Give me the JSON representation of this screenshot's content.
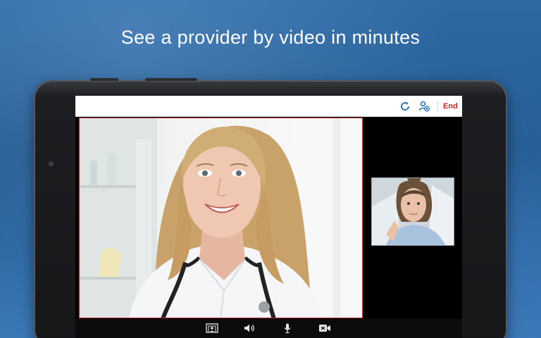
{
  "headline": "See a provider by video in minutes",
  "topbar": {
    "end_label": "End",
    "icons": [
      "refresh-icon",
      "add-participant-icon"
    ],
    "accent_color": "#d0232a",
    "icon_color": "#1f6fb8"
  },
  "controls": {
    "icons": [
      "switch-camera-icon",
      "speaker-icon",
      "microphone-icon",
      "video-toggle-icon"
    ]
  }
}
